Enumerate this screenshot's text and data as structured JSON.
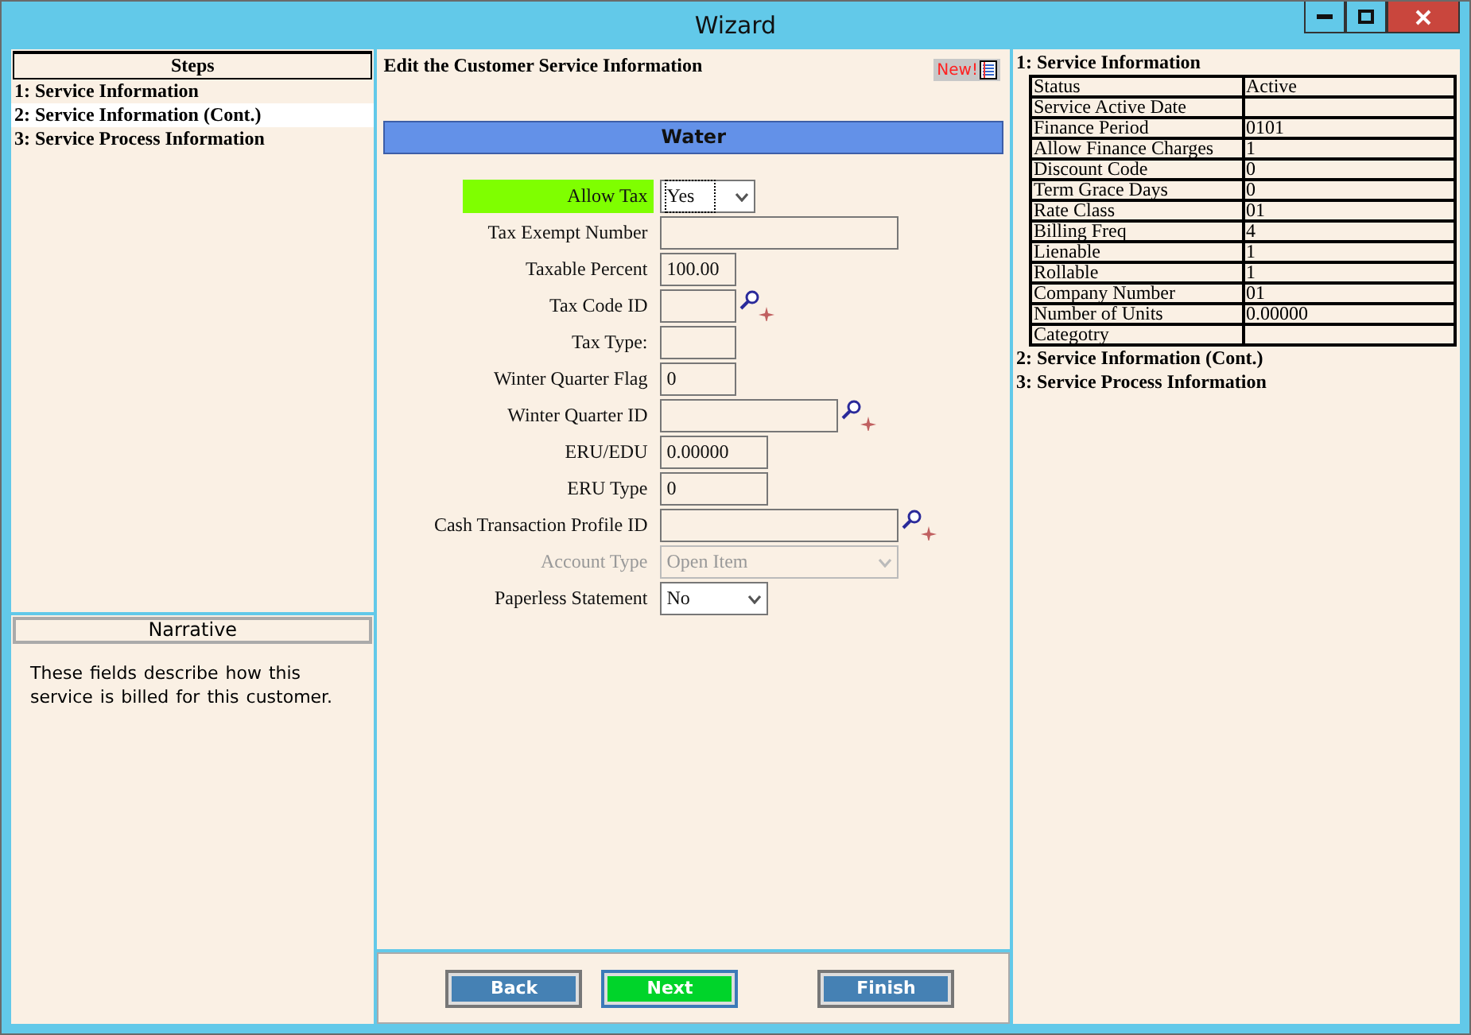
{
  "window": {
    "title": "Wizard"
  },
  "steps": {
    "title": "Steps",
    "items": [
      {
        "label": "1: Service Information",
        "selected": false
      },
      {
        "label": "2: Service Information (Cont.)",
        "selected": true
      },
      {
        "label": "3: Service Process Information",
        "selected": false
      }
    ]
  },
  "narrative": {
    "title": "Narrative",
    "text": "These fields describe how this service is billed for this customer."
  },
  "form": {
    "heading": "Edit the Customer Service Information",
    "new_button": "New!",
    "section": "Water",
    "fields": [
      {
        "label": "Allow Tax",
        "kind": "select",
        "value": "Yes",
        "highlighted": true,
        "disabled": false,
        "focused": true
      },
      {
        "label": "Tax Exempt Number",
        "kind": "text",
        "highlighted": false,
        "disabled": false,
        "focused": false
      },
      {
        "label": "Taxable Percent",
        "kind": "text",
        "value": "100.00",
        "highlighted": false,
        "disabled": false,
        "focused": false
      },
      {
        "label": "Tax Code ID",
        "kind": "lookup",
        "highlighted": false,
        "disabled": false,
        "focused": false
      },
      {
        "label": "Tax Type:",
        "kind": "text",
        "highlighted": false,
        "disabled": false,
        "focused": false
      },
      {
        "label": "Winter Quarter Flag",
        "kind": "text",
        "value": "0",
        "highlighted": false,
        "disabled": false,
        "focused": false
      },
      {
        "label": "Winter Quarter ID",
        "kind": "lookup",
        "highlighted": false,
        "disabled": false,
        "focused": false
      },
      {
        "label": "ERU/EDU",
        "kind": "text",
        "value": "0.00000",
        "highlighted": false,
        "disabled": false,
        "focused": false
      },
      {
        "label": "ERU Type",
        "kind": "text",
        "value": "0",
        "highlighted": false,
        "disabled": false,
        "focused": false
      },
      {
        "label": "Cash Transaction Profile ID",
        "kind": "lookup",
        "highlighted": false,
        "disabled": false,
        "focused": false
      },
      {
        "label": "Account Type",
        "kind": "select",
        "value": "Open Item",
        "highlighted": false,
        "disabled": true,
        "focused": false
      },
      {
        "label": "Paperless Statement",
        "kind": "select",
        "value": "No",
        "highlighted": false,
        "disabled": false,
        "focused": false
      }
    ]
  },
  "buttons": [
    {
      "label": "Back",
      "highlighted": false
    },
    {
      "label": "Next",
      "highlighted": true
    },
    {
      "label": "Finish",
      "highlighted": false
    }
  ],
  "summary": {
    "sections": [
      {
        "title": "1: Service Information",
        "rows": [
          [
            "Status",
            "Active"
          ],
          [
            "Service Active Date",
            ""
          ],
          [
            "Finance Period",
            "0101"
          ],
          [
            "Allow Finance Charges",
            "1"
          ],
          [
            "Discount Code",
            "0"
          ],
          [
            "Term Grace Days",
            "0"
          ],
          [
            "Rate Class",
            "01"
          ],
          [
            "Billing Freq",
            "4"
          ],
          [
            "Lienable",
            "1"
          ],
          [
            "Rollable",
            "1"
          ],
          [
            "Company Number",
            "01"
          ],
          [
            "Number of Units",
            "0.00000"
          ],
          [
            "Categotry",
            ""
          ]
        ]
      },
      {
        "title": "2: Service Information (Cont.)"
      },
      {
        "title": "3: Service Process Information"
      }
    ]
  }
}
